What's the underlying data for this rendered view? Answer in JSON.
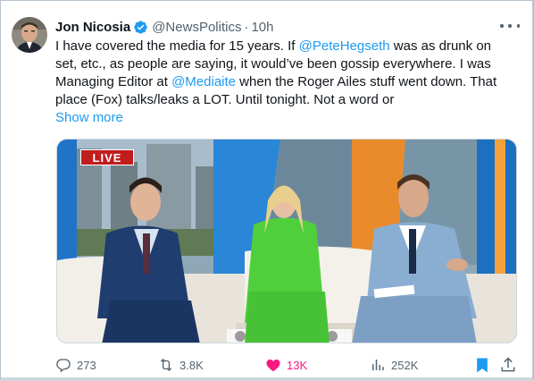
{
  "tweet": {
    "author_name": "Jon Nicosia",
    "handle": "@NewsPolitics",
    "separator": "·",
    "time": "10h",
    "text_lines": [
      {
        "pre": "I have covered the media for 15 years. If ",
        "mention": "@PeteHegseth",
        "post": " was as drunk on"
      },
      {
        "pre": "set, etc., as people are saying, it would’ve been gossip everywhere.  I was",
        "mention": "",
        "post": ""
      },
      {
        "pre": "Managing Editor at ",
        "mention": "@Mediaite",
        "post": " when the Roger Ailes stuff went down. That"
      },
      {
        "pre": "place (Fox) talks/leaks a LOT.  Until tonight. Not a word or",
        "mention": "",
        "post": ""
      }
    ],
    "show_more": "Show more"
  },
  "media": {
    "live_badge": "LIVE"
  },
  "actions": {
    "replies": "273",
    "reposts": "3.8K",
    "likes": "13K",
    "views": "252K"
  },
  "colors": {
    "accent": "#1d9bf0",
    "like": "#f91880",
    "muted": "#536471",
    "text": "#0f1419"
  },
  "icons": [
    "more-icon",
    "verified-badge-icon",
    "reply-icon",
    "repost-icon",
    "like-icon",
    "views-icon",
    "bookmark-icon",
    "share-icon"
  ]
}
